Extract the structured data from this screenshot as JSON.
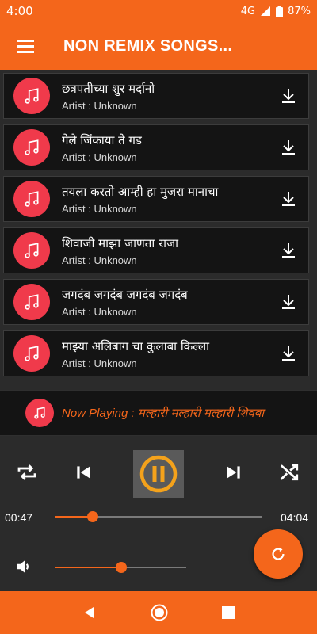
{
  "status": {
    "time": "4:00",
    "network": "4G",
    "battery": "87%"
  },
  "appbar": {
    "title": "NON REMIX SONGS..."
  },
  "songs": [
    {
      "title": "छत्रपतीच्या शुर मर्दानो",
      "artist": "Artist : Unknown"
    },
    {
      "title": "गेले जिंकाया ते गड",
      "artist": "Artist : Unknown"
    },
    {
      "title": "तयला करतो आम्ही हा मुजरा मानाचा",
      "artist": "Artist : Unknown"
    },
    {
      "title": "शिवाजी माझा जाणता राजा",
      "artist": "Artist : Unknown"
    },
    {
      "title": "जगदंब जगदंब जगदंब जगदंब",
      "artist": "Artist : Unknown"
    },
    {
      "title": "माझ्या अलिबाग चा कुलाबा किल्ला",
      "artist": "Artist : Unknown"
    }
  ],
  "now_playing": {
    "text": "Now Playing : मल्हारी मल्हारी मल्हारी शिवबा"
  },
  "player": {
    "elapsed": "00:47",
    "duration": "04:04",
    "progress": 0.18,
    "volume": 0.5
  },
  "colors": {
    "accent": "#f4661b",
    "disc": "#f03a4b",
    "background": "#2b2b2b",
    "row": "#141414"
  },
  "icons": [
    "menu-icon",
    "music-note-icon",
    "download-icon",
    "repeat-icon",
    "previous-icon",
    "pause-icon",
    "next-icon",
    "shuffle-icon",
    "volume-icon",
    "refresh-icon",
    "back-icon",
    "home-icon",
    "recents-icon"
  ]
}
